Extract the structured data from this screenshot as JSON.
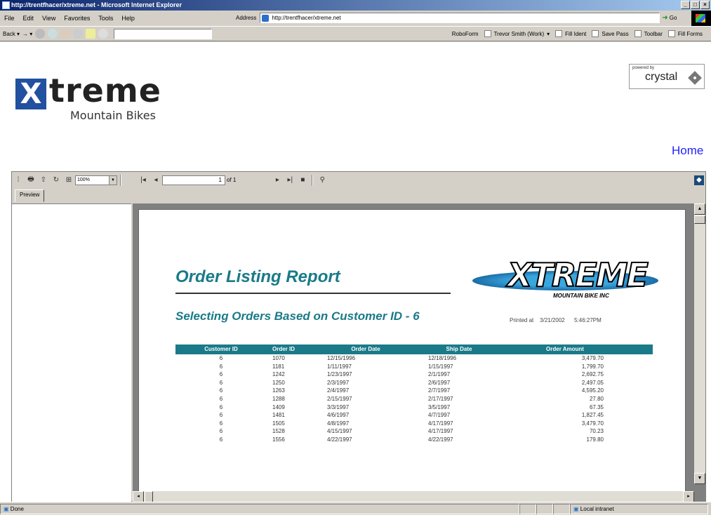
{
  "window": {
    "title": "http://trentfhacer/xtreme.net - Microsoft Internet Explorer"
  },
  "menu": [
    "File",
    "Edit",
    "View",
    "Favorites",
    "Tools",
    "Help"
  ],
  "address": {
    "label": "Address",
    "url": "http://trentfhacer/xtreme.net",
    "go": "Go"
  },
  "toolbar": {
    "back": "Back",
    "items": [
      "RoboForm",
      "Trevor Smith (Work)",
      "Fill Ident",
      "Save Pass",
      "Toolbar",
      "Fill Forms"
    ]
  },
  "branding": {
    "logo_box": "X",
    "logo_word": "treme",
    "logo_sub": "Mountain Bikes",
    "crystal_powered": "powered by",
    "crystal_name": "crystal",
    "home": "Home"
  },
  "viewer": {
    "zoom": "100%",
    "page": "1",
    "page_of": "of 1",
    "tab": "Preview"
  },
  "report": {
    "title": "Order Listing Report",
    "subtitle": "Selecting Orders Based on Customer ID - 6",
    "printed_label": "Printed at",
    "printed_date": "3/21/2002",
    "printed_time": "5:46:27PM",
    "logo_text": "XTREME",
    "logo_sub": "MOUNTAIN BIKE INC"
  },
  "table": {
    "headers": [
      "Customer ID",
      "Order ID",
      "Order Date",
      "Ship Date",
      "Order Amount"
    ],
    "rows": [
      [
        "6",
        "1070",
        "12/15/1996",
        "12/18/1996",
        "3,479.70"
      ],
      [
        "6",
        "1181",
        "1/11/1997",
        "1/15/1997",
        "1,799.70"
      ],
      [
        "6",
        "1242",
        "1/23/1997",
        "2/1/1997",
        "2,692.75"
      ],
      [
        "6",
        "1250",
        "2/3/1997",
        "2/6/1997",
        "2,497.05"
      ],
      [
        "6",
        "1263",
        "2/4/1997",
        "2/7/1997",
        "4,595.20"
      ],
      [
        "6",
        "1288",
        "2/15/1997",
        "2/17/1997",
        "27.80"
      ],
      [
        "6",
        "1409",
        "3/3/1997",
        "3/5/1997",
        "67.35"
      ],
      [
        "6",
        "1481",
        "4/6/1997",
        "4/7/1997",
        "1,827.45"
      ],
      [
        "6",
        "1505",
        "4/8/1997",
        "4/17/1997",
        "3,479.70"
      ],
      [
        "6",
        "1528",
        "4/15/1997",
        "4/17/1997",
        "70.23"
      ],
      [
        "6",
        "1556",
        "4/22/1997",
        "4/22/1997",
        "179.80"
      ]
    ]
  },
  "status": {
    "left": "Done",
    "zone": "Local intranet"
  }
}
